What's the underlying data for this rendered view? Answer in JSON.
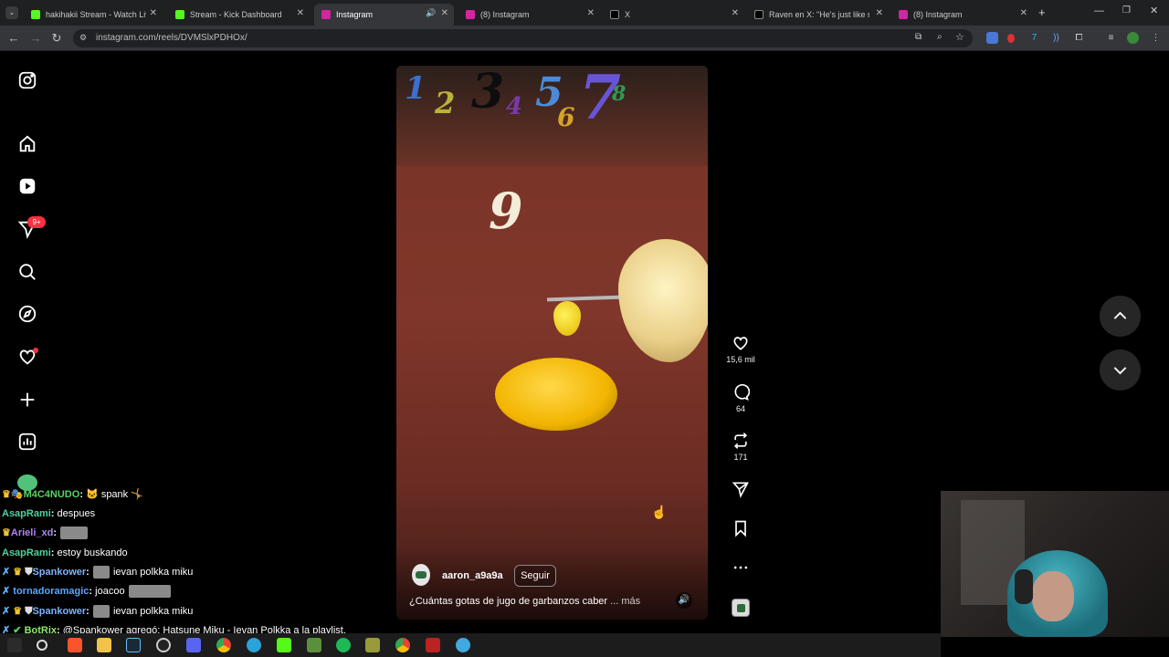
{
  "browser": {
    "tabs": [
      {
        "title": "hakihakii Stream - Watch Live o",
        "fav_color": "#53fc18",
        "active": false
      },
      {
        "title": "Stream - Kick Dashboard",
        "fav_color": "#53fc18",
        "active": false
      },
      {
        "title": "Instagram",
        "fav_color": "#d6249f",
        "active": true
      },
      {
        "title": "(8) Instagram",
        "fav_color": "#d6249f",
        "active": false
      },
      {
        "title": "X",
        "fav_color": "#000000",
        "active": false
      },
      {
        "title": "Raven en X: \"He's just like me e",
        "fav_color": "#000000",
        "active": false
      },
      {
        "title": "(8) Instagram",
        "fav_color": "#d6249f",
        "active": false
      }
    ],
    "new_tab_label": "+",
    "url": "instagram.com/reels/DVMSlxPDHOx/"
  },
  "sidebar": {
    "notification_badge": "9+"
  },
  "reel": {
    "numbers": [
      "1",
      "2",
      "3",
      "4",
      "5",
      "6",
      "7",
      "8",
      "9"
    ],
    "author": "aaron_a9a9a",
    "follow_label": "Seguir",
    "caption": "¿Cuántas gotas de jugo de garbanzos caber",
    "caption_more": "... más",
    "likes": "15,6 mil",
    "comments": "64",
    "reposts": "171"
  },
  "chat": [
    {
      "name": "M4C4NUDO",
      "color": "#56d364",
      "message": "spank"
    },
    {
      "name": "AsapRami",
      "color": "#4fd1a0",
      "message": "despues"
    },
    {
      "name": "Arieli_xd",
      "color": "#b084f5",
      "message": ""
    },
    {
      "name": "AsapRami",
      "color": "#4fd1a0",
      "message": "estoy buskando"
    },
    {
      "name": "Spankower",
      "color": "#7fb2ff",
      "message": "ievan polkka miku"
    },
    {
      "name": "tornadoramagic",
      "color": "#59a6ff",
      "message": "joacoo"
    },
    {
      "name": "Spankower",
      "color": "#7fb2ff",
      "message": "ievan polkka miku"
    },
    {
      "name": "BotRix",
      "color": "#8eea69",
      "message": "@Spankower agregó: Hatsune Miku - Ievan Polkka a la playlist."
    }
  ],
  "colors": {
    "ig_bg": "#000000",
    "chrome_tab": "#35363a",
    "badge_red": "#ff3040"
  }
}
